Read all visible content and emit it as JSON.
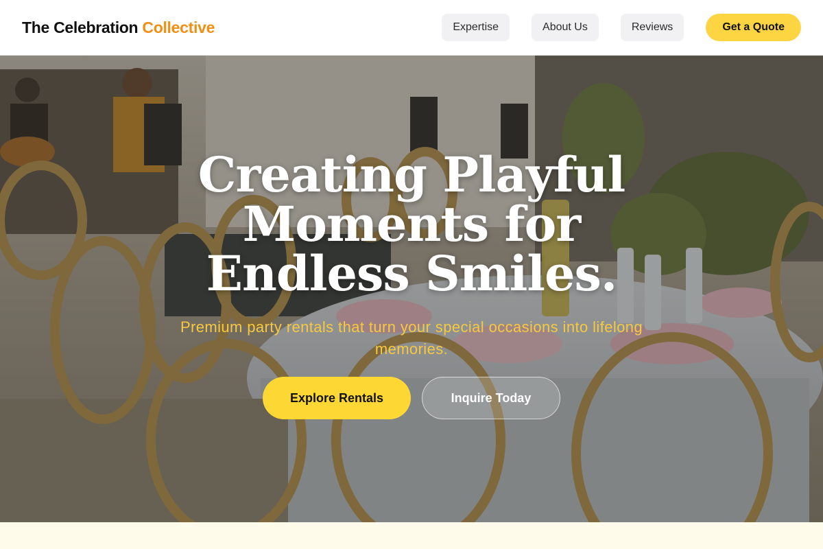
{
  "header": {
    "brand_main": "The Celebration",
    "brand_accent": "Collective",
    "nav": [
      "Expertise",
      "About Us",
      "Reviews"
    ],
    "cta": "Get a Quote"
  },
  "hero": {
    "title": "Creating Playful Moments for Endless Smiles.",
    "subtitle": "Premium party rentals that turn your special occasions into lifelong memories.",
    "primary_button": "Explore Rentals",
    "secondary_button": "Inquire Today"
  },
  "colors": {
    "accent_orange": "#ef8f14",
    "cta_yellow": "#fdd442",
    "subtitle_yellow": "#f6c940",
    "section_cream": "#fffbeb"
  },
  "icons": [
    "hero-photo"
  ]
}
